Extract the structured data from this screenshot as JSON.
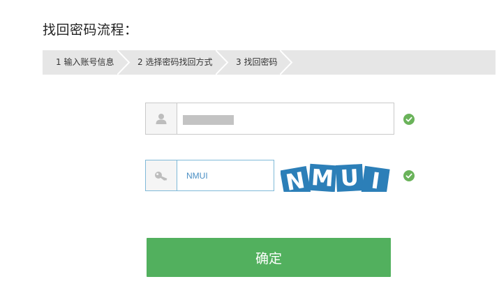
{
  "page": {
    "title": "找回密码流程："
  },
  "steps": [
    {
      "label": "1 输入账号信息"
    },
    {
      "label": "2 选择密码找回方式"
    },
    {
      "label": "3 找回密码"
    }
  ],
  "form": {
    "account": {
      "icon": "user-icon",
      "value_masked": true,
      "valid": true
    },
    "captcha": {
      "icon": "key-icon",
      "value": "NMUI",
      "valid": true,
      "image_text": "NMUI"
    },
    "submit_label": "确定"
  },
  "colors": {
    "step_bar": "#e6e6e6",
    "check": "#6ab35a",
    "button": "#52b05e",
    "focus_border": "#7fb9d8",
    "captcha_tile": "#2c7fb8"
  }
}
